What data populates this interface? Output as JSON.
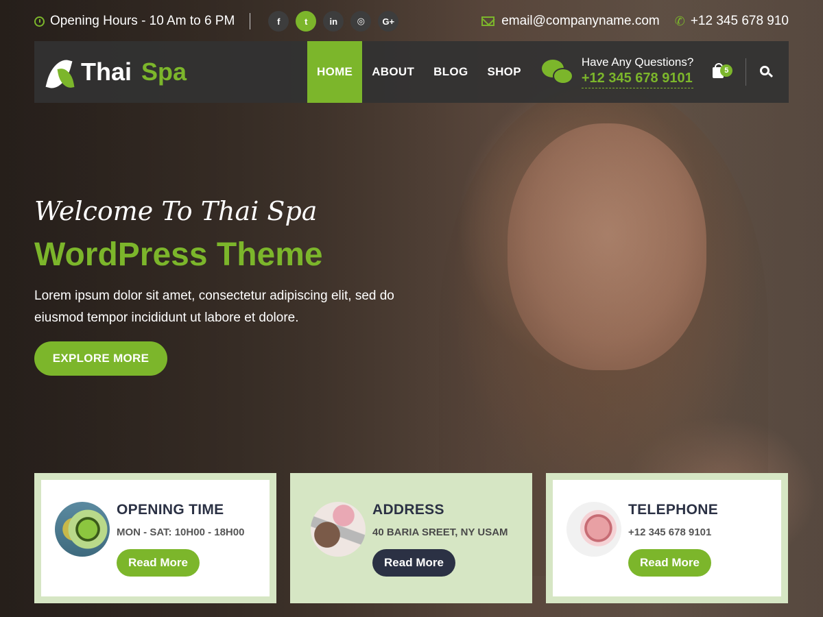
{
  "topbar": {
    "hours": "Opening Hours - 10 Am to 6 PM",
    "socials": [
      {
        "icon": "facebook-icon",
        "glyph": "f",
        "active": false
      },
      {
        "icon": "twitter-icon",
        "glyph": "t",
        "active": true
      },
      {
        "icon": "linkedin-icon",
        "glyph": "in",
        "active": false
      },
      {
        "icon": "instagram-icon",
        "glyph": "◎",
        "active": false
      },
      {
        "icon": "google-plus-icon",
        "glyph": "G+",
        "active": false
      }
    ],
    "email": "email@companyname.com",
    "phone": "+12 345 678 910"
  },
  "logo": {
    "word1": "Thai",
    "word2": "Spa"
  },
  "nav": {
    "items": [
      "HOME",
      "ABOUT",
      "BLOG",
      "SHOP"
    ],
    "active": "HOME",
    "questions_label": "Have Any Questions?",
    "questions_phone": "+12 345 678 9101",
    "cart_count": "5"
  },
  "hero": {
    "welcome": "Welcome To Thai Spa",
    "headline": "WordPress Theme",
    "lead": "Lorem ipsum dolor sit amet, consectetur adipiscing elit, sed do eiusmod tempor incididunt ut labore et dolore.",
    "cta": "EXPLORE MORE"
  },
  "cards": [
    {
      "title": "OPENING TIME",
      "sub": "MON - SAT: 10H00 - 18H00",
      "button": "Read More"
    },
    {
      "title": "ADDRESS",
      "sub": "40 BARIA SREET, NY USAM",
      "button": "Read More"
    },
    {
      "title": "TELEPHONE",
      "sub": "+12 345 678 9101",
      "button": "Read More"
    }
  ],
  "colors": {
    "accent": "#7cb62b",
    "dark": "#2b3144",
    "card_frame": "#d6e6c4"
  }
}
